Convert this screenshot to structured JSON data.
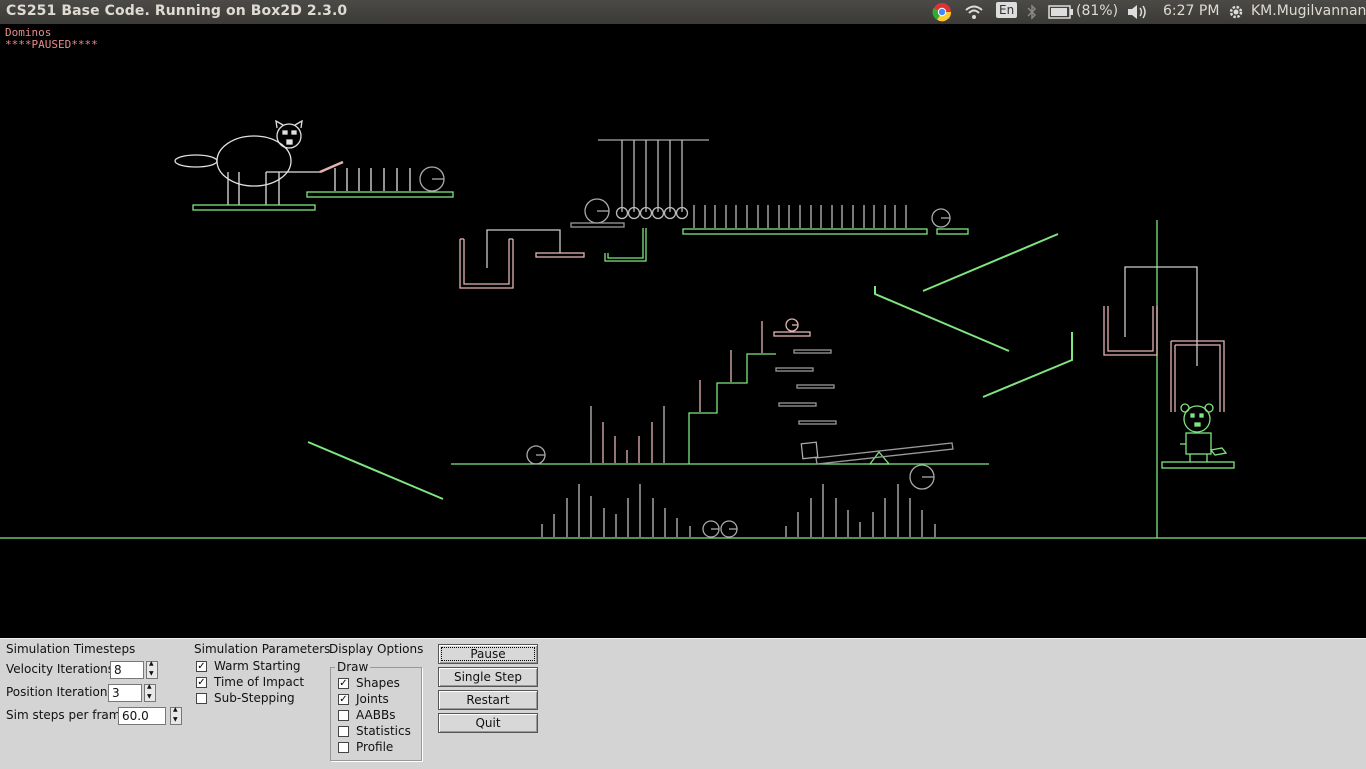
{
  "window": {
    "title": "CS251 Base Code. Running on Box2D 2.3.0"
  },
  "tray": {
    "lang": "En",
    "battery": "(81%)",
    "time": "6:27 PM",
    "user": "KM.Mugilvannan",
    "icons": [
      "chrome-icon",
      "wifi-icon",
      "bluetooth-icon",
      "battery-icon",
      "volume-icon",
      "gear-icon"
    ]
  },
  "sim": {
    "test_name": "Dominos",
    "status": "****PAUSED****"
  },
  "colors": {
    "static": "#7fe57f",
    "dynamic": "#e5b2b2",
    "sleeping": "#999999",
    "panel": "#d4d4d4"
  },
  "panel": {
    "timesteps": {
      "heading": "Simulation Timesteps",
      "velocity_label": "Velocity Iterations",
      "velocity_value": "8",
      "position_label": "Position Iterations",
      "position_value": "3",
      "hz_label": "Sim steps per frame",
      "hz_value": "60.0"
    },
    "params": {
      "heading": "Simulation Parameters",
      "items": [
        {
          "label": "Warm Starting",
          "checked": true
        },
        {
          "label": "Time of Impact",
          "checked": true
        },
        {
          "label": "Sub-Stepping",
          "checked": false
        }
      ]
    },
    "display": {
      "heading": "Display Options",
      "group_label": "Draw",
      "items": [
        {
          "label": "Shapes",
          "checked": true
        },
        {
          "label": "Joints",
          "checked": true
        },
        {
          "label": "AABBs",
          "checked": false
        },
        {
          "label": "Statistics",
          "checked": false
        },
        {
          "label": "Profile",
          "checked": false
        }
      ]
    },
    "buttons": {
      "pause": "Pause",
      "single_step": "Single Step",
      "restart": "Restart",
      "quit": "Quit"
    }
  }
}
